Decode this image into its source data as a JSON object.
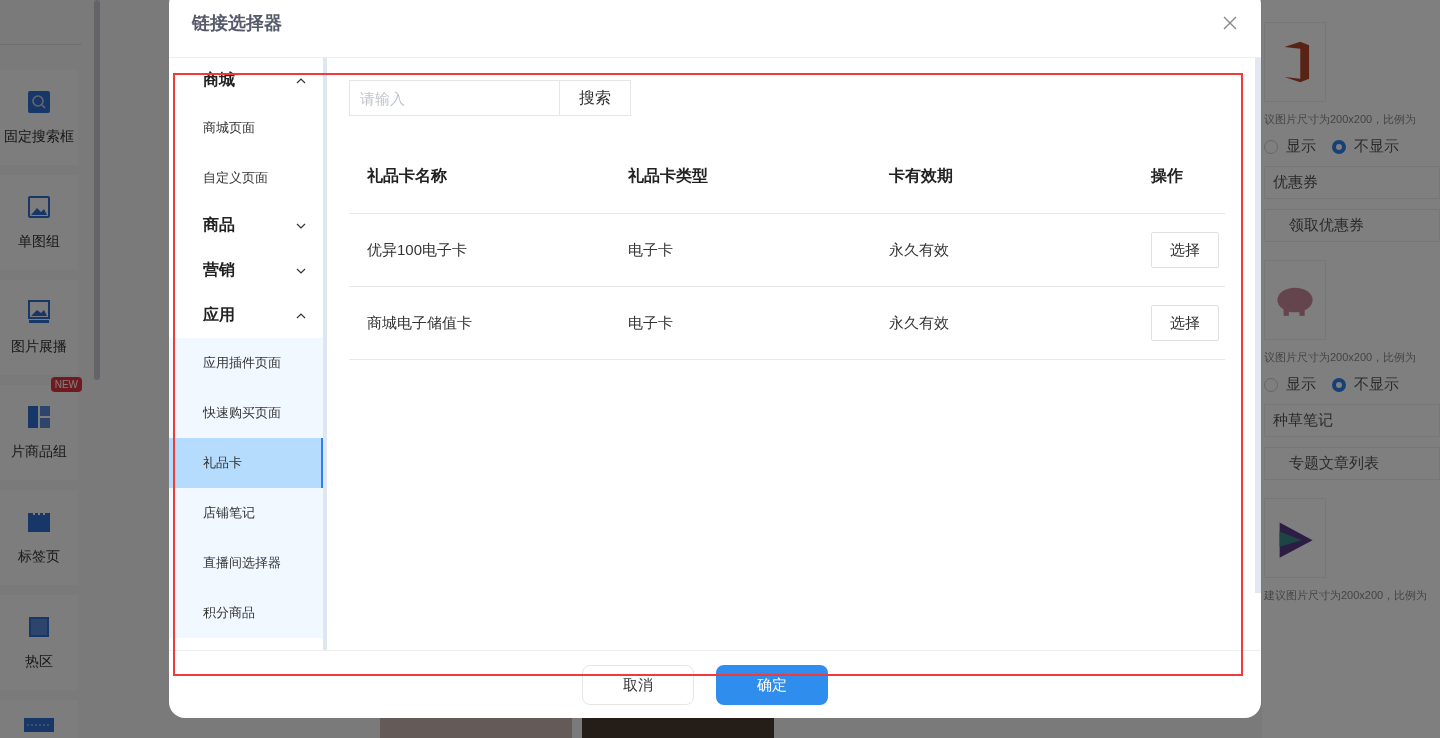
{
  "background": {
    "left_tiles": [
      {
        "kind": "search",
        "label": "固定搜索框"
      },
      {
        "kind": "image",
        "label": "单图组"
      },
      {
        "kind": "slides",
        "label": "图片展播"
      },
      {
        "kind": "grid",
        "label": "片商品组",
        "badge": "NEW"
      },
      {
        "kind": "tabs",
        "label": "标签页"
      },
      {
        "kind": "hotspot",
        "label": "热区"
      },
      {
        "kind": "divider"
      }
    ],
    "right_cards": [
      {
        "kind": "office",
        "hint": "议图片尺寸为200x200，比例为",
        "options": [
          {
            "label": "显示",
            "selected": false
          },
          {
            "label": "不显示",
            "selected": true
          }
        ],
        "title_field": "优惠券",
        "link_field": "领取优惠券"
      },
      {
        "kind": "pig",
        "hint": "议图片尺寸为200x200，比例为",
        "options": [
          {
            "label": "显示",
            "selected": false
          },
          {
            "label": "不显示",
            "selected": true
          }
        ],
        "title_field": "种草笔记",
        "link_field": "专题文章列表"
      },
      {
        "kind": "play",
        "hint": "建议图片尺寸为200x200，比例为"
      }
    ]
  },
  "dialog": {
    "title": "链接选择器",
    "menu": [
      {
        "label": "商城",
        "expanded": true,
        "children": [
          {
            "label": "商城页面",
            "selected": false
          },
          {
            "label": "自定义页面",
            "selected": false
          }
        ]
      },
      {
        "label": "商品",
        "expanded": false
      },
      {
        "label": "营销",
        "expanded": false
      },
      {
        "label": "应用",
        "expanded": true,
        "children": [
          {
            "label": "应用插件页面",
            "selected": false
          },
          {
            "label": "快速购买页面",
            "selected": false
          },
          {
            "label": "礼品卡",
            "selected": true
          },
          {
            "label": "店铺笔记",
            "selected": false
          },
          {
            "label": "直播间选择器",
            "selected": false
          },
          {
            "label": "积分商品",
            "selected": false
          }
        ]
      }
    ],
    "search": {
      "placeholder": "请输入",
      "button": "搜索"
    },
    "table": {
      "columns": [
        "礼品卡名称",
        "礼品卡类型",
        "卡有效期",
        "操作"
      ],
      "rows": [
        {
          "name": "优异100电子卡",
          "type": "电子卡",
          "validity": "永久有效",
          "action": "选择"
        },
        {
          "name": "商城电子储值卡",
          "type": "电子卡",
          "validity": "永久有效",
          "action": "选择"
        }
      ]
    },
    "buttons": {
      "cancel": "取消",
      "confirm": "确定"
    }
  }
}
